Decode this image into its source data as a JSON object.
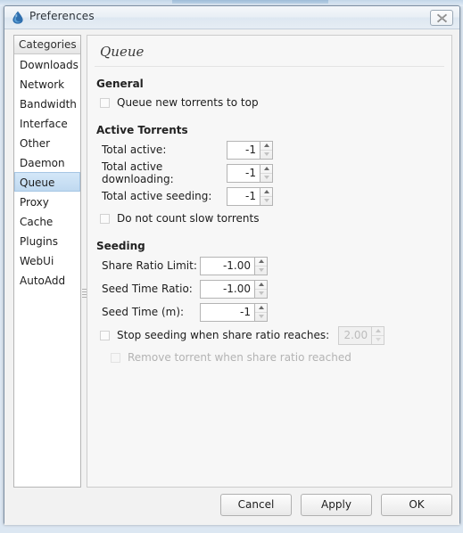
{
  "window": {
    "title": "Preferences",
    "icon": "water-drop-icon",
    "close_label": "✕"
  },
  "sidebar": {
    "header": "Categories",
    "selected": "Queue",
    "items": [
      {
        "label": "Downloads"
      },
      {
        "label": "Network"
      },
      {
        "label": "Bandwidth"
      },
      {
        "label": "Interface"
      },
      {
        "label": "Other"
      },
      {
        "label": "Daemon"
      },
      {
        "label": "Queue"
      },
      {
        "label": "Proxy"
      },
      {
        "label": "Cache"
      },
      {
        "label": "Plugins"
      },
      {
        "label": "WebUi"
      },
      {
        "label": "AutoAdd"
      }
    ]
  },
  "content": {
    "title": "Queue",
    "sections": {
      "general": {
        "heading": "General",
        "queue_new_top": {
          "label": "Queue new torrents to top",
          "checked": false
        }
      },
      "active_torrents": {
        "heading": "Active Torrents",
        "total_active": {
          "label": "Total active:",
          "value": "-1"
        },
        "total_active_downloading": {
          "label": "Total active downloading:",
          "value": "-1"
        },
        "total_active_seeding": {
          "label": "Total active seeding:",
          "value": "-1"
        },
        "do_not_count_slow": {
          "label": "Do not count slow torrents",
          "checked": false
        }
      },
      "seeding": {
        "heading": "Seeding",
        "share_ratio_limit": {
          "label": "Share Ratio Limit:",
          "value": "-1.00"
        },
        "seed_time_ratio": {
          "label": "Seed Time Ratio:",
          "value": "-1.00"
        },
        "seed_time": {
          "label": "Seed Time (m):",
          "value": "-1"
        },
        "stop_seeding": {
          "label": "Stop seeding when share ratio reaches:",
          "checked": false,
          "value": "2.00",
          "disabled_field": true
        },
        "remove_torrent": {
          "label": "Remove torrent when share ratio reached",
          "checked": false,
          "disabled": true
        }
      }
    }
  },
  "footer": {
    "cancel": "Cancel",
    "apply": "Apply",
    "ok": "OK"
  },
  "colors": {
    "selection": "#bfd9f0",
    "accent": "#2b6ca3",
    "desktop": "#dce7f2"
  }
}
